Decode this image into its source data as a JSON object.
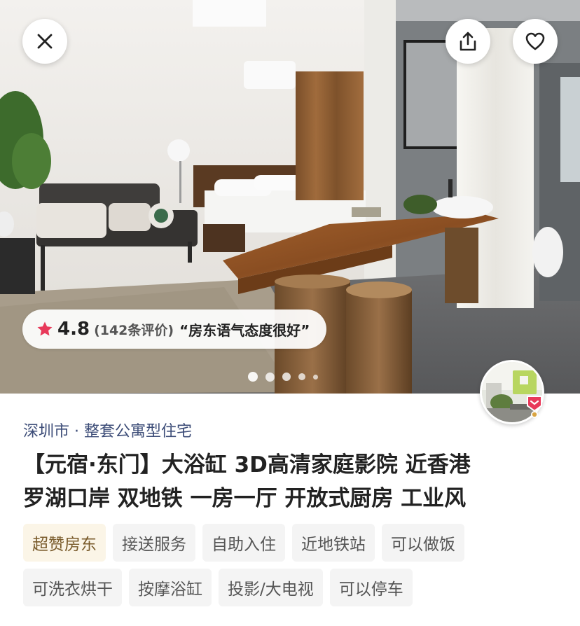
{
  "colors": {
    "rating_star": "#e8395a",
    "location_text": "#3d4d78",
    "title_text": "#222222",
    "tag_bg": "#f4f4f4",
    "tag_text": "#555555",
    "highlight_tag_bg": "#fbf5e7",
    "highlight_tag_text": "#7a5c2c"
  },
  "toolbar": {
    "close_icon": "close-icon",
    "share_icon": "share-icon",
    "favorite_icon": "heart-icon"
  },
  "gallery": {
    "image_count": 5,
    "active_index": 0
  },
  "rating": {
    "score": "4.8",
    "count_text": "(142条评价)",
    "quote": "“房东语气态度很好”"
  },
  "listing": {
    "location": "深圳市 · 整套公寓型住宅",
    "title_line1": "【元宿·东门】大浴缸 3D高清家庭影院 近香港",
    "title_line2": "罗湖口岸 双地铁 一房一厅 开放式厨房 工业风"
  },
  "tags": {
    "row1": [
      {
        "label": "超赞房东",
        "highlight": true
      },
      {
        "label": "接送服务"
      },
      {
        "label": "自助入住"
      },
      {
        "label": "近地铁站"
      },
      {
        "label": "可以做饭"
      }
    ],
    "row2": [
      {
        "label": "可洗衣烘干"
      },
      {
        "label": "按摩浴缸"
      },
      {
        "label": "投影/大电视"
      },
      {
        "label": "可以停车"
      }
    ]
  }
}
